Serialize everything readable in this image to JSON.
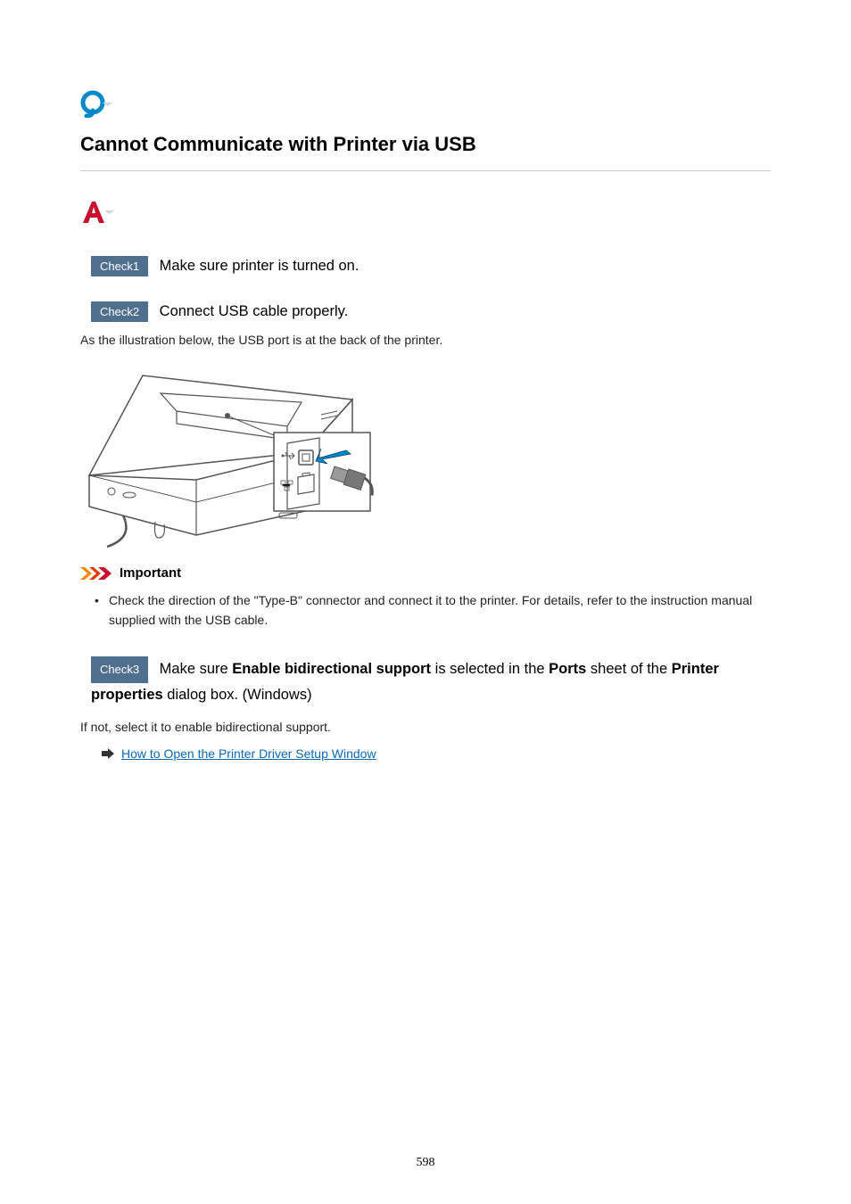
{
  "title": "Cannot Communicate with Printer via USB",
  "check1": {
    "badge": "Check1",
    "text": "Make sure printer is turned on."
  },
  "check2": {
    "badge": "Check2",
    "text": "Connect USB cable properly.",
    "desc": "As the illustration below, the USB port is at the back of the printer."
  },
  "important": {
    "label": "Important",
    "bullet": "Check the direction of the \"Type-B\" connector and connect it to the printer. For details, refer to the instruction manual supplied with the USB cable."
  },
  "check3": {
    "badge": "Check3",
    "pre": " Make sure ",
    "bold1": "Enable bidirectional support",
    "mid1": " is selected in the ",
    "bold2": "Ports",
    "mid2": " sheet of the ",
    "bold3": "Printer properties",
    "post": " dialog box. (Windows)",
    "desc": "If not, select it to enable bidirectional support.",
    "link": "How to Open the Printer Driver Setup Window"
  },
  "page_number": "598"
}
